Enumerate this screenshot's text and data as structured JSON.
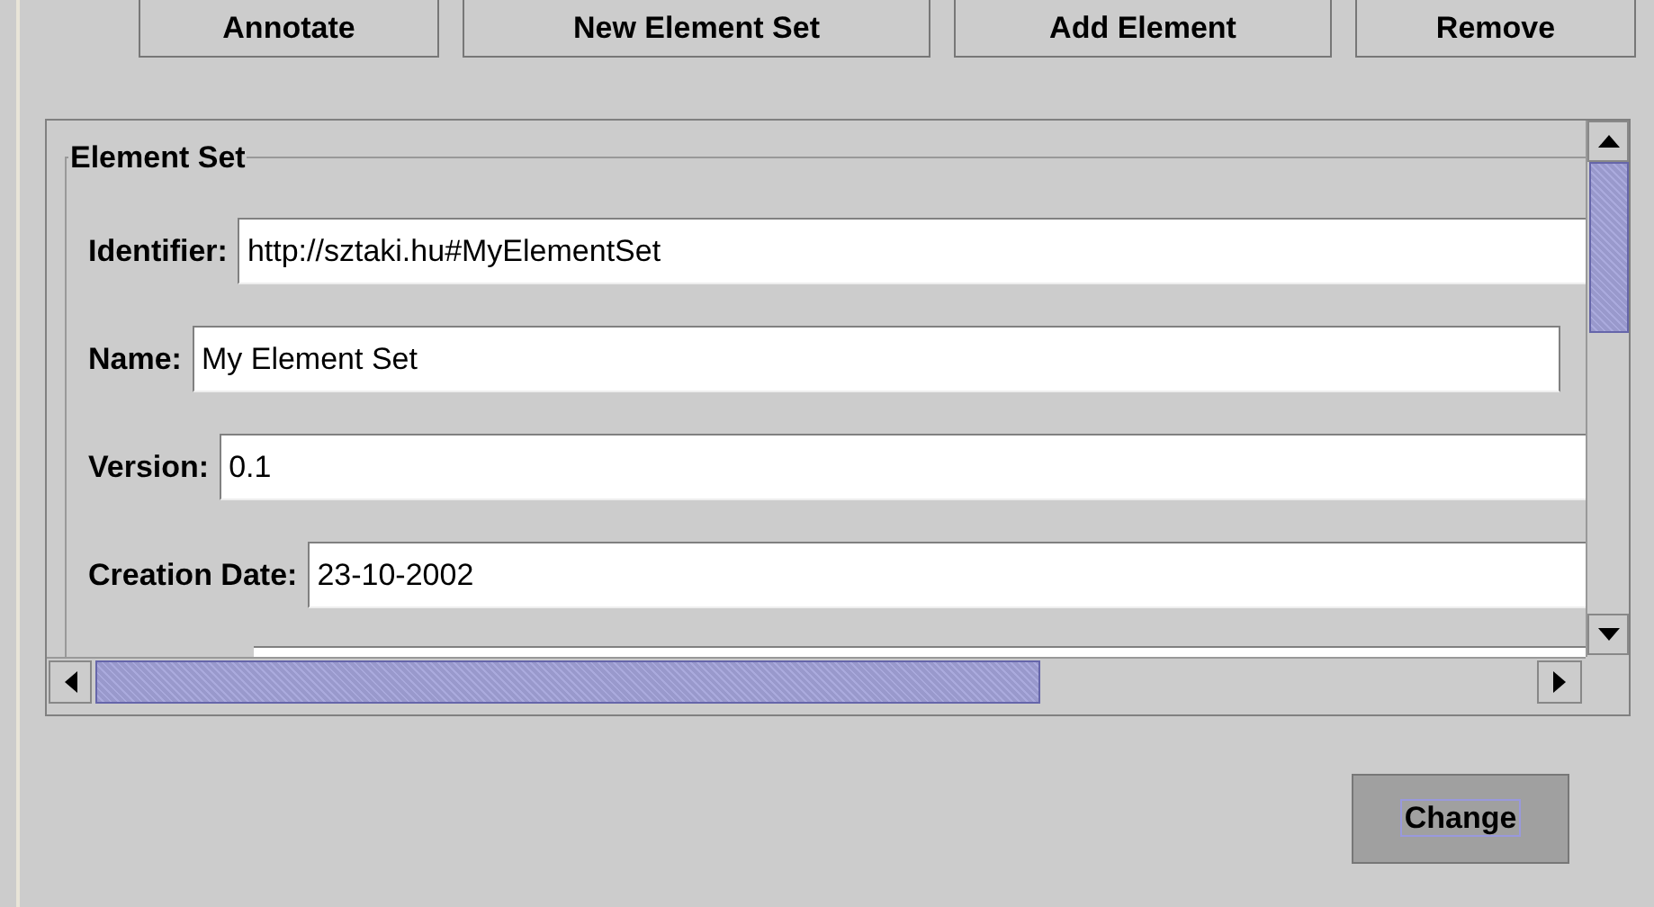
{
  "toolbar_buttons": [
    {
      "label": "Annotate"
    },
    {
      "label": "New Element Set"
    },
    {
      "label": "Add Element"
    },
    {
      "label": "Remove"
    }
  ],
  "panel": {
    "title": "Element Set",
    "fields": [
      {
        "label": "Identifier:",
        "value": "http://sztaki.hu#MyElementSet"
      },
      {
        "label": "Name:",
        "value": "My Element Set"
      },
      {
        "label": "Version:",
        "value": "0.1"
      },
      {
        "label": "Creation Date:",
        "value": "23-10-2002"
      }
    ]
  },
  "change_button": {
    "label": "Change"
  }
}
